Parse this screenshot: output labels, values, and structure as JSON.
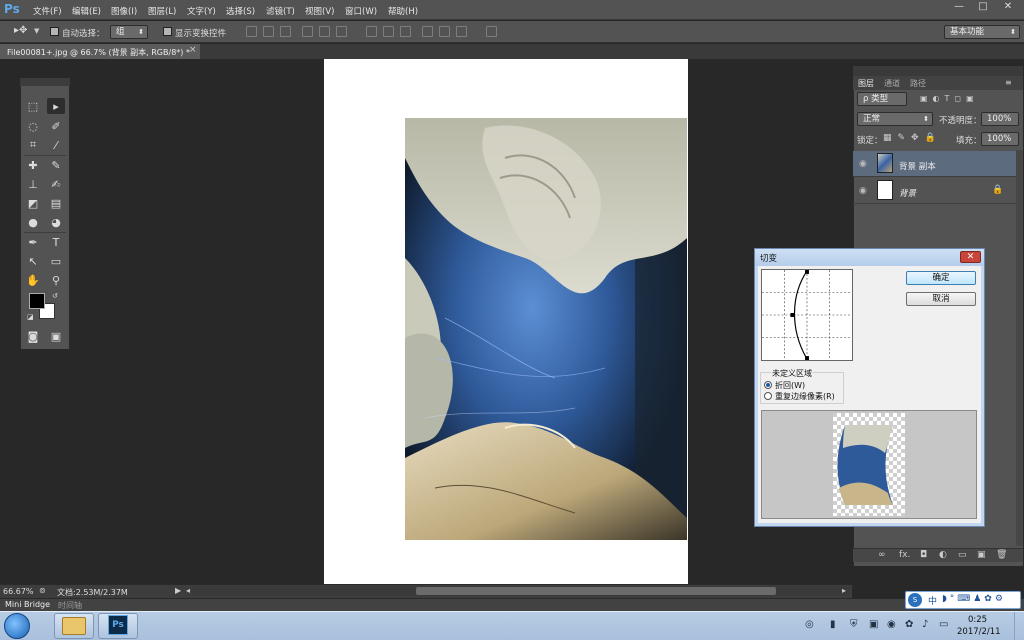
{
  "app": {
    "logo": "Ps",
    "accent": "#5fa9e8"
  },
  "menu": [
    "文件(F)",
    "编辑(E)",
    "图像(I)",
    "图层(L)",
    "文字(Y)",
    "选择(S)",
    "滤镜(T)",
    "视图(V)",
    "窗口(W)",
    "帮助(H)"
  ],
  "window_controls": {
    "minimize": "—",
    "restore": "□",
    "close": "✕"
  },
  "options": {
    "auto_select_label": "自动选择：",
    "auto_select_value": "组",
    "show_transform_label": "显示变换控件",
    "workspace": "基本功能"
  },
  "document": {
    "tab_title": "File00081+.jpg @ 66.7% (背景 副本, RGB/8*) *",
    "close": "×"
  },
  "layers_panel": {
    "tabs": [
      "图层",
      "通道",
      "路径"
    ],
    "filter_label": "ρ 类型",
    "blend_mode": "正常",
    "opacity_label": "不透明度：",
    "opacity_value": "100%",
    "lock_label": "锁定：",
    "fill_label": "填充：",
    "fill_value": "100%",
    "layers": [
      {
        "name": "背景 副本",
        "selected": true
      },
      {
        "name": "背景",
        "selected": false,
        "locked": true
      }
    ],
    "footer_icons": [
      "∞",
      "fx.",
      "◘",
      "◐",
      "▭",
      "▣",
      "🗑"
    ]
  },
  "dialog": {
    "title": "切变",
    "ok_label": "确定",
    "cancel_label": "取消",
    "undefined_area_label": "未定义区域",
    "wrap_label": "折回(W)",
    "repeat_label": "重复边缘像素(R)",
    "selected_option": "wrap"
  },
  "status": {
    "zoom": "66.67%",
    "doc_size": "文档:2.53M/2.37M"
  },
  "bottom_tabs": [
    "Mini Bridge",
    "时间轴"
  ],
  "ime": {
    "label": "中"
  },
  "taskbar": {
    "time": "0:25",
    "date": "2017/2/11"
  }
}
